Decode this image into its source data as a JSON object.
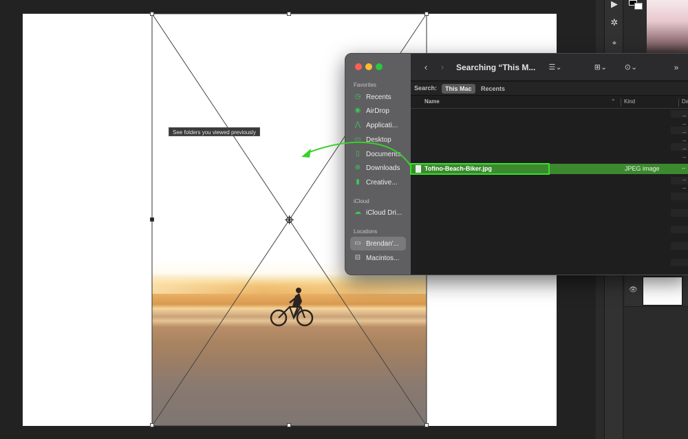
{
  "tooltip": {
    "text": "See folders you viewed previously"
  },
  "finder": {
    "title": "Searching “This M...",
    "search_label": "Search:",
    "scopes": [
      "This Mac",
      "Recents"
    ],
    "sidebar": {
      "favorites_header": "Favorites",
      "favorites": [
        {
          "label": "Recents",
          "icon": "clock-icon"
        },
        {
          "label": "AirDrop",
          "icon": "airdrop-icon"
        },
        {
          "label": "Applicati...",
          "icon": "applications-icon"
        },
        {
          "label": "Desktop",
          "icon": "desktop-icon"
        },
        {
          "label": "Documents",
          "icon": "document-icon"
        },
        {
          "label": "Downloads",
          "icon": "downloads-icon"
        },
        {
          "label": "Creative...",
          "icon": "file-icon"
        }
      ],
      "icloud_header": "iCloud",
      "icloud": [
        {
          "label": "iCloud Dri...",
          "icon": "cloud-icon"
        }
      ],
      "locations_header": "Locations",
      "locations": [
        {
          "label": "Brendan'...",
          "icon": "laptop-icon",
          "selected": true
        },
        {
          "label": "Macintos...",
          "icon": "disk-icon"
        }
      ]
    },
    "columns": {
      "name": "Name",
      "kind": "Kind",
      "date": "Da"
    },
    "dash": "--",
    "file": {
      "name": "Tofino-Beach-Biker.jpg",
      "kind": "JPEG image"
    }
  },
  "colors": {
    "selection_green": "#3b8a2e",
    "highlight_green": "#38e02a",
    "sidebar_icon_green": "#3ec75a"
  }
}
